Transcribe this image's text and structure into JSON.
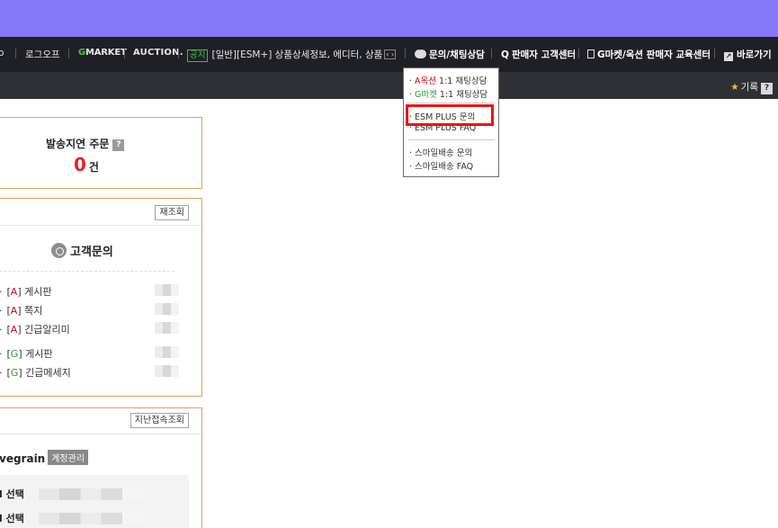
{
  "nav": {
    "logout_partial": "o",
    "logoff": "로그오프",
    "gmarket_logo": "MARKET",
    "gmarket_g": "G",
    "auction_logo": "AUCTION.",
    "notice_badge": "공지",
    "notice_text": "[일반][ESM+] 상품상세정보, 에디터, 상품",
    "ticker_arrows": "‹ ›",
    "inquiry_chat": "문의/채팅상담",
    "seller_center": "판매자 고객센터",
    "edu_center": "G마켓/옥션 판매자 교육센터",
    "shortcut": "바로가기",
    "q_icon": "Q",
    "link_icon": "↗"
  },
  "subbar": {
    "record": "기록",
    "help": "?"
  },
  "dropdown": {
    "items": [
      {
        "brand": "A옥션",
        "label": " 1:1 채팅상담"
      },
      {
        "brand": "G마켓",
        "label": " 1:1 채팅상담"
      },
      {
        "label": "ESM PLUS 문의"
      },
      {
        "label": "ESM PLUS FAQ"
      },
      {
        "label": "스마일배송 문의"
      },
      {
        "label": "스마일배송 FAQ"
      }
    ]
  },
  "delay_panel": {
    "title": "발송지연 주문",
    "help": "?",
    "count": "0",
    "unit": "건"
  },
  "cs_panel": {
    "refresh": "재조회",
    "title": "고객문의",
    "items": [
      {
        "brand": "A",
        "label": "게시판"
      },
      {
        "brand": "A",
        "label": "쪽지"
      },
      {
        "brand": "A",
        "label": "긴급알리미"
      },
      {
        "brand": "G",
        "label": "게시판"
      },
      {
        "brand": "G",
        "label": "긴급메세지"
      }
    ]
  },
  "account_panel": {
    "last_login": "지난접속조회",
    "account_id": "vegrain",
    "manage": "계정관리",
    "rows": [
      "l 선택",
      "l 선택"
    ]
  },
  "colors": {
    "accent_top": "#8677f6",
    "nav_bg": "#1f2026",
    "panel_border": "#d9a25e",
    "highlight": "#ee1111"
  }
}
